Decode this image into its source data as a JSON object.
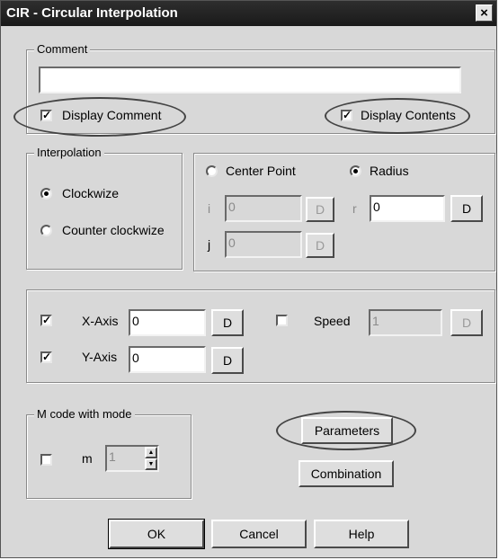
{
  "window": {
    "title": "CIR - Circular Interpolation",
    "close_glyph": "×"
  },
  "comment": {
    "legend": "Comment",
    "value": "",
    "display_comment": {
      "label": "Display Comment",
      "checked": true
    },
    "display_contents": {
      "label": "Display Contents",
      "checked": true
    }
  },
  "interpolation": {
    "legend": "Interpolation",
    "clockwize": {
      "label": "Clockwize",
      "selected": true
    },
    "counter": {
      "label": "Counter clockwize",
      "selected": false
    }
  },
  "center": {
    "center_point": {
      "label": "Center Point",
      "selected": false
    },
    "radius": {
      "label": "Radius",
      "selected": true
    },
    "i_label": "i",
    "i_value": "0",
    "j_label": "j",
    "j_value": "0",
    "r_label": "r",
    "r_value": "0",
    "d_label": "D"
  },
  "axes": {
    "x": {
      "label": "X-Axis",
      "checked": true,
      "value": "0"
    },
    "y": {
      "label": "Y-Axis",
      "checked": true,
      "value": "0"
    },
    "speed": {
      "label": "Speed",
      "checked": false,
      "value": "1"
    },
    "d_label": "D"
  },
  "mcode": {
    "legend": "M code with mode",
    "m_label": "m",
    "m_checked": false,
    "m_value": "1"
  },
  "buttons": {
    "parameters": "Parameters",
    "combination": "Combination",
    "ok": "OK",
    "cancel": "Cancel",
    "help": "Help"
  }
}
